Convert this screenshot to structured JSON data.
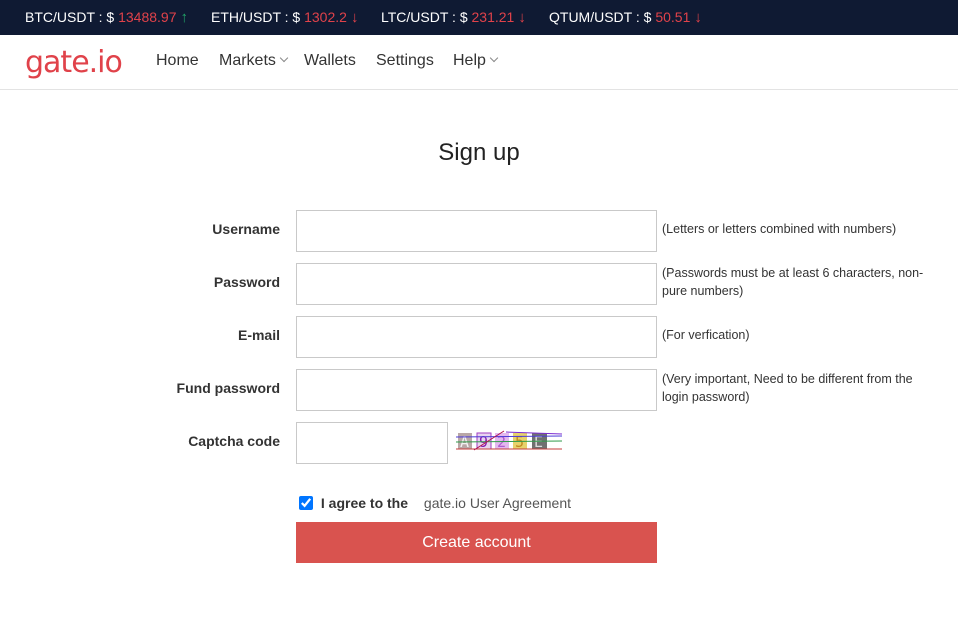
{
  "ticker": [
    {
      "pair": "BTC/USDT",
      "price": "13488.97",
      "trend": "up",
      "arrow": "↑"
    },
    {
      "pair": "ETH/USDT",
      "price": "1302.2",
      "trend": "down",
      "arrow": "↓"
    },
    {
      "pair": "LTC/USDT",
      "price": "231.21",
      "trend": "down",
      "arrow": "↓"
    },
    {
      "pair": "QTUM/USDT",
      "price": "50.51",
      "trend": "down",
      "arrow": "↓"
    }
  ],
  "ticker_sep": " : $ ",
  "logo": "gate.io",
  "nav": {
    "home": "Home",
    "markets": "Markets",
    "wallets": "Wallets",
    "settings": "Settings",
    "help": "Help"
  },
  "form": {
    "title": "Sign up",
    "username_label": "Username",
    "username_hint": "(Letters or letters combined with numbers)",
    "password_label": "Password",
    "password_hint": "(Passwords must be at least 6 characters, non-pure numbers)",
    "email_label": "E-mail",
    "email_hint": "(For verfication)",
    "fund_password_label": "Fund password",
    "fund_password_hint": "(Very important, Need to be different from the login password)",
    "captcha_label": "Captcha code",
    "captcha_chars": [
      "A",
      "9",
      "2",
      "5",
      "E"
    ],
    "agree_checked": true,
    "agree_text": "I agree to the",
    "agreement_link": "gate.io User Agreement",
    "submit": "Create account"
  },
  "colors": {
    "ticker_bg": "#0f1a33",
    "brand": "#e0424a",
    "up": "#22a86a",
    "down": "#e0424a",
    "button": "#d9534f"
  }
}
